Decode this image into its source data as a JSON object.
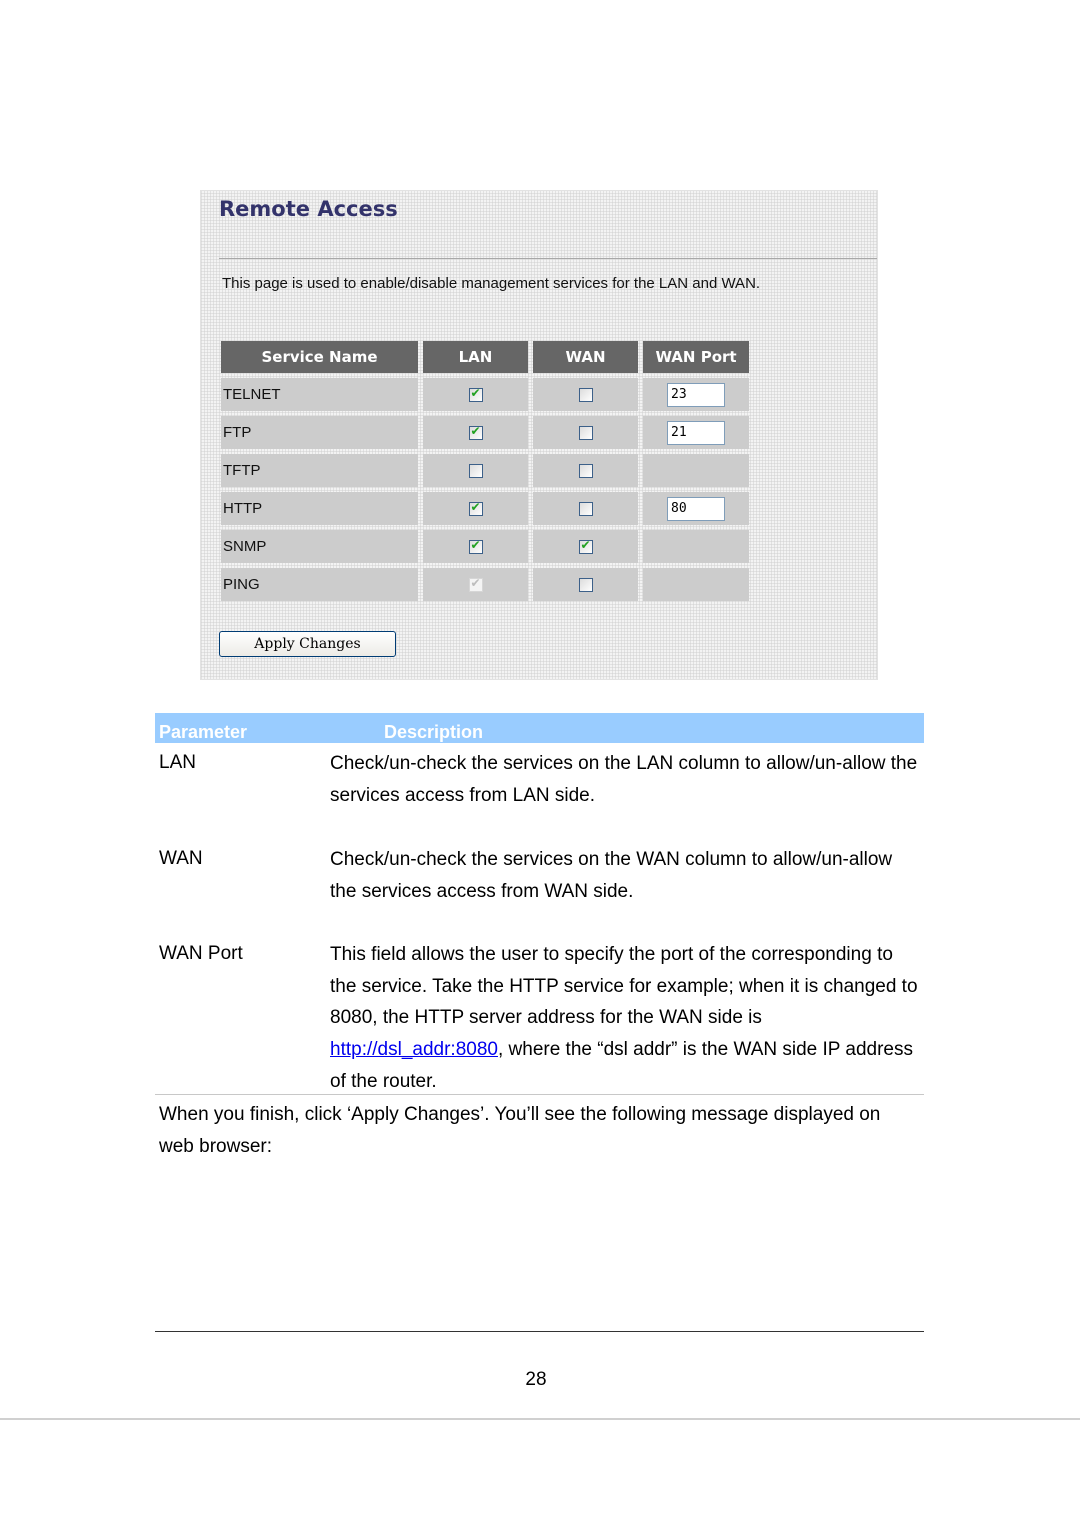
{
  "screenshot": {
    "title": "Remote Access",
    "description": "This page is used to enable/disable management services for the LAN and WAN.",
    "columns": [
      "Service Name",
      "LAN",
      "WAN",
      "WAN Port"
    ],
    "rows": [
      {
        "service": "TELNET",
        "lan": "checked",
        "wan": "unchecked",
        "port": "23"
      },
      {
        "service": "FTP",
        "lan": "checked",
        "wan": "unchecked",
        "port": "21"
      },
      {
        "service": "TFTP",
        "lan": "unchecked",
        "wan": "unchecked",
        "port": null
      },
      {
        "service": "HTTP",
        "lan": "checked",
        "wan": "unchecked",
        "port": "80"
      },
      {
        "service": "SNMP",
        "lan": "checked",
        "wan": "checked",
        "port": null
      },
      {
        "service": "PING",
        "lan": "checked-disabled",
        "wan": "unchecked",
        "port": null
      }
    ],
    "apply_label": "Apply Changes"
  },
  "param_table": {
    "header_parameter": "Parameter",
    "header_description": "Description",
    "colors": {
      "header_bg": "#99ccff",
      "header_text": "#ffffff"
    },
    "rows": [
      {
        "label": "LAN",
        "text": "Check/un-check the services on the LAN column to allow/un-allow the services access from LAN side."
      },
      {
        "label": "WAN",
        "text": "Check/un-check the services on the WAN column to allow/un-allow the services access from WAN side."
      },
      {
        "label": "WAN Port",
        "text_before_link": "This field allows the user to specify the port of the corresponding to the service. Take the HTTP service for example; when it is changed to 8080, the HTTP server address for the WAN side is ",
        "link": "http://dsl_addr:8080",
        "text_after_link": ", where the “dsl addr” is the WAN side IP address of the router."
      }
    ]
  },
  "after_text": "When you finish, click ‘Apply Changes’. You’ll see the following message displayed on web browser:",
  "page_number": "28"
}
